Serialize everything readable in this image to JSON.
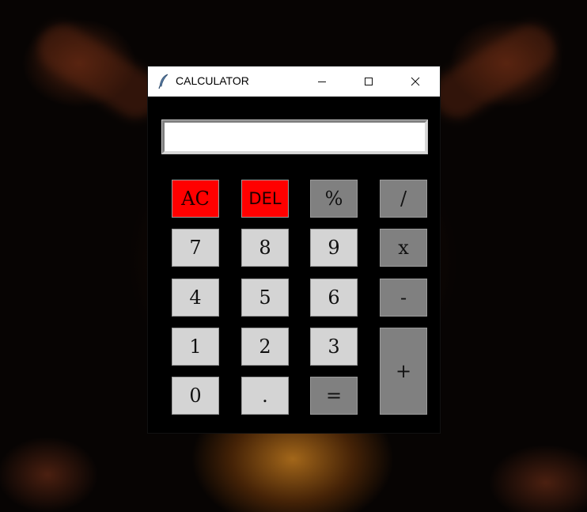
{
  "window": {
    "title": "CALCULATOR",
    "controls": {
      "minimize_icon": "minimize-icon",
      "maximize_icon": "maximize-icon",
      "close_icon": "close-icon"
    }
  },
  "display": {
    "value": ""
  },
  "keys": {
    "ac": "AC",
    "del": "DEL",
    "percent": "%",
    "divide": "/",
    "seven": "7",
    "eight": "8",
    "nine": "9",
    "multiply": "x",
    "four": "4",
    "five": "5",
    "six": "6",
    "minus": "-",
    "one": "1",
    "two": "2",
    "three": "3",
    "plus": "+",
    "zero": "0",
    "dot": ".",
    "equals": "="
  },
  "colors": {
    "clear_keys": "#ff0000",
    "operator_keys": "#808080",
    "number_keys": "#d4d4d4",
    "window_body": "#000000"
  }
}
